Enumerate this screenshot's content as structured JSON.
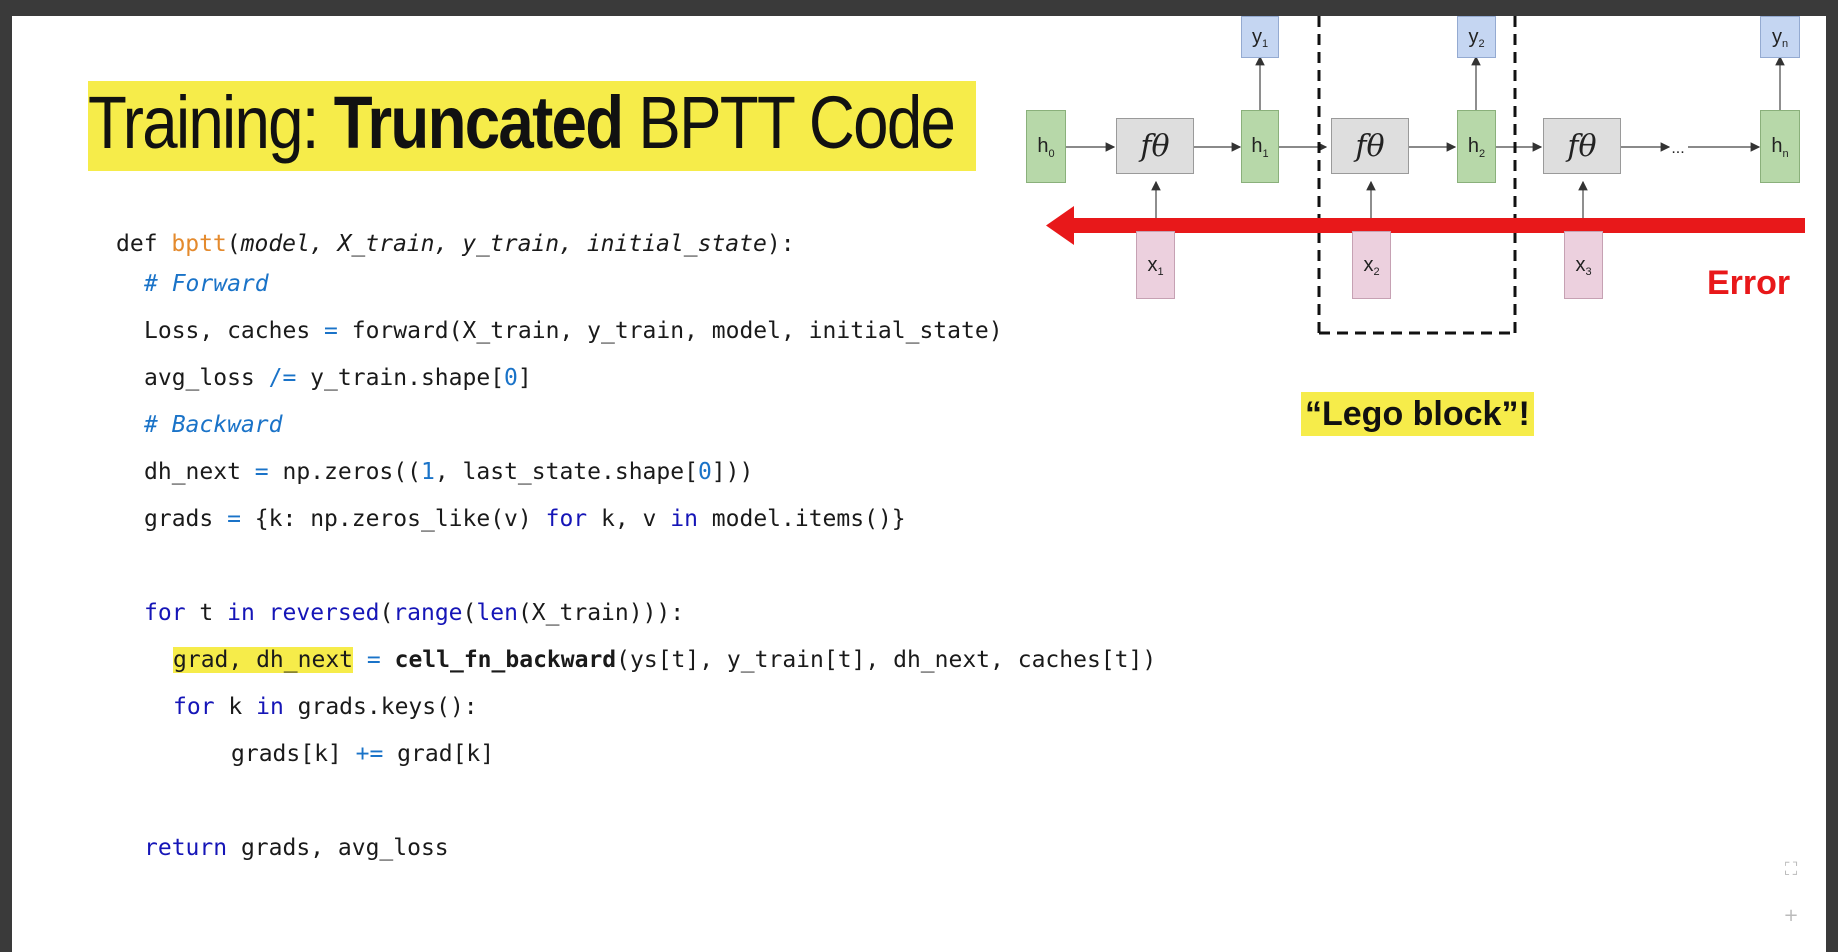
{
  "slide": {
    "title_plain_1": "Training: ",
    "title_bold": "Truncated",
    "title_plain_2": " BPTT Code"
  },
  "code": {
    "l1": {
      "kw": "def ",
      "fn": "bptt",
      "open": "(",
      "args": "model, X_train, y_train, initial_state",
      "close": "):"
    },
    "l2": {
      "comment": "# Forward"
    },
    "l3": {
      "a": "Loss, caches ",
      "op": "=",
      "b": " forward(X_train, y_train, model, initial_state)"
    },
    "l4": {
      "a": "avg_loss ",
      "op": "/=",
      "b": " y_train.shape[",
      "num": "0",
      "c": "]"
    },
    "l5": {
      "comment": "# Backward"
    },
    "l6": {
      "a": "dh_next ",
      "op": "=",
      "b": " np.zeros((",
      "num1": "1",
      "c": ", last_state.shape[",
      "num2": "0",
      "d": "]))"
    },
    "l7": {
      "a": "grads ",
      "op": "=",
      "b": " {k: np.zeros_like(v) ",
      "kw1": "for",
      "c": " k, v ",
      "kw2": "in",
      "d": " model.items()}"
    },
    "l8": {
      "kw1": "for",
      "a": " t ",
      "kw2": "in",
      "sp": " ",
      "kw3": "reversed",
      "b": "(",
      "kw4": "range",
      "c": "(",
      "kw5": "len",
      "d": "(X_train))):"
    },
    "l9": {
      "hl": "grad, dh_next",
      "sp": " ",
      "op": "=",
      "sp2": " ",
      "bold": "cell_fn_backward",
      "b": "(ys[t], y_train[t], dh_next, caches[t])"
    },
    "l10": {
      "kw1": "for",
      "a": " k ",
      "kw2": "in",
      "b": " grads.keys():"
    },
    "l11": {
      "a": "grads[k] ",
      "op": "+=",
      "b": " grad[k]"
    },
    "l12": {
      "kw": "return",
      "a": " grads, avg_loss"
    }
  },
  "diagram": {
    "f_label": "fθ",
    "ellipsis": "...",
    "h_nodes": [
      {
        "base": "h",
        "sub": "0"
      },
      {
        "base": "h",
        "sub": "1"
      },
      {
        "base": "h",
        "sub": "2"
      },
      {
        "base": "h",
        "sub": "n"
      }
    ],
    "x_nodes": [
      {
        "base": "x",
        "sub": "1"
      },
      {
        "base": "x",
        "sub": "2"
      },
      {
        "base": "x",
        "sub": "3"
      }
    ],
    "y_nodes": [
      {
        "base": "y",
        "sub": "1"
      },
      {
        "base": "y",
        "sub": "2"
      },
      {
        "base": "y",
        "sub": "n"
      }
    ],
    "error_label": "Error"
  },
  "callout": "“Lego block”!",
  "controls": {
    "fullscreen_icon": "fullscreen-icon",
    "zoom_icon": "plus-icon"
  },
  "colors": {
    "highlight": "#f6ec4a",
    "error_arrow": "#e8181a",
    "keyword": "#1515b7",
    "function": "#e48a2d",
    "comment": "#1a73c8"
  }
}
